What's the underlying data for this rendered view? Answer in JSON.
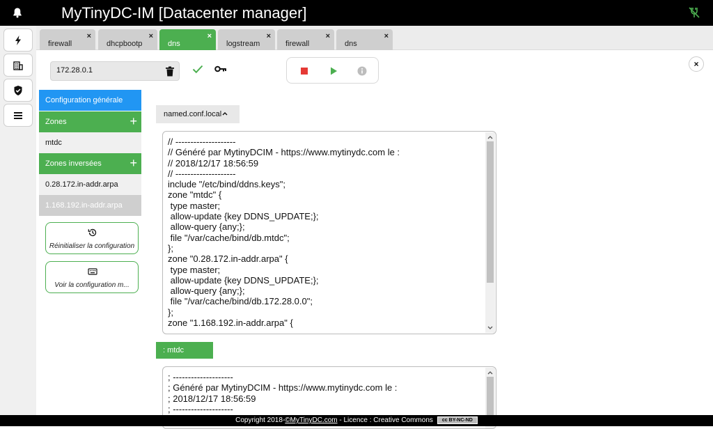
{
  "header": {
    "title": "MyTinyDC-IM [Datacenter manager]",
    "bell_icon": "bell-icon",
    "network_icon": "network-off-icon"
  },
  "rail": {
    "items": [
      {
        "icon": "bolt-icon"
      },
      {
        "icon": "building-icon"
      },
      {
        "icon": "shield-check-icon"
      },
      {
        "icon": "list-icon"
      }
    ]
  },
  "tabs": [
    {
      "label": "firewall",
      "close": "×",
      "active": false
    },
    {
      "label": "dhcpbootp",
      "close": "×",
      "active": false
    },
    {
      "label": "dns",
      "close": "×",
      "active": true
    },
    {
      "label": "logstream",
      "close": "×",
      "active": false
    },
    {
      "label": "firewall",
      "close": "×",
      "active": false
    },
    {
      "label": "dns",
      "close": "×",
      "active": false
    }
  ],
  "toolbar": {
    "ip_value": "172.28.0.1",
    "close_label": "×"
  },
  "sidebar": {
    "general": "Configuration générale",
    "zones": "Zones",
    "zones_add": "+",
    "zone_items": [
      "mtdc"
    ],
    "reverse_zones": "Zones inversées",
    "reverse_add": "+",
    "reverse_items": [
      "0.28.172.in-addr.arpa",
      "1.168.192.in-addr.arpa"
    ],
    "reset_label": "Réinitialiser la configuration",
    "view_label": "Voir la configuration m..."
  },
  "main": {
    "file1_label": "named.conf.local",
    "file1_content": "// --------------------\n// Généré par MytinyDCIM - https://www.mytinydc.com le :\n// 2018/12/17 18:56:59\n// --------------------\ninclude \"/etc/bind/ddns.keys\";\nzone \"mtdc\" {\n type master;\n allow-update {key DDNS_UPDATE;};\n allow-query {any;};\n file \"/var/cache/bind/db.mtdc\";\n};\nzone \"0.28.172.in-addr.arpa\" {\n type master;\n allow-update {key DDNS_UPDATE;};\n allow-query {any;};\n file \"/var/cache/bind/db.172.28.0.0\";\n};\nzone \"1.168.192.in-addr.arpa\" {",
    "zone_label": ": mtdc",
    "file2_content": "; --------------------\n; Généré par MytinyDCIM - https://www.mytinydc.com le :\n; 2018/12/17 18:56:59\n; --------------------"
  },
  "footer": {
    "copyright": "Copyright 2018-",
    "site": "©MyTinyDC.com",
    "licence": " - Licence : Creative Commons",
    "badge": "cc BY-NC-ND"
  }
}
